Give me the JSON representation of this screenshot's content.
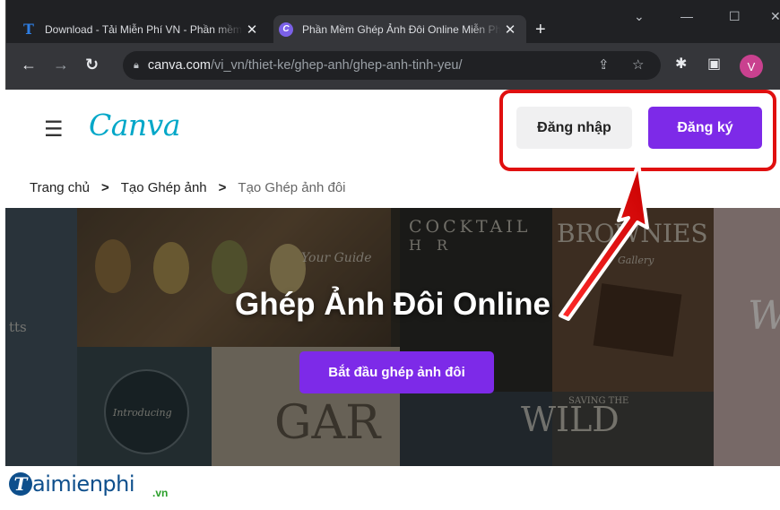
{
  "browser": {
    "tabs": [
      {
        "title": "Download - Tải Miễn Phí VN - Phần mềm",
        "favicon": "T"
      },
      {
        "title": "Phần Mềm Ghép Ảnh Đôi Online Miễn Phí",
        "favicon": "C"
      }
    ],
    "tab_close_glyph": "✕",
    "new_tab_glyph": "+",
    "address": {
      "host": "canva.com",
      "path": "/vi_vn/thiet-ke/ghep-anh/ghep-anh-tinh-yeu/"
    },
    "profile_initial": "V"
  },
  "header": {
    "logo": "Canva",
    "login_label": "Đăng nhập",
    "signup_label": "Đăng ký"
  },
  "breadcrumb": {
    "items": [
      "Trang chủ",
      "Tạo Ghép ảnh",
      "Tạo Ghép ảnh đôi"
    ],
    "separator": ">"
  },
  "hero": {
    "title": "Ghép Ảnh Đôi Online",
    "cta_label": "Bắt đầu ghép ảnh đôi",
    "tile_texts": {
      "cocktail": "COCKTAIL",
      "hr": "H R",
      "brownies": "BROWNIES",
      "gallery": "Gallery",
      "your_guide": "Your Guide",
      "wild": "WILD",
      "saving_the": "SAVING THE",
      "introducing": "Introducing",
      "gar": "GAR",
      "tts": "tts"
    }
  },
  "watermark": {
    "initial": "T",
    "name": "aimienphi",
    "tld": ".vn"
  },
  "colors": {
    "brand_purple": "#7d2ae8",
    "canva_teal": "#00a7c8",
    "annotation_red": "#e01010"
  }
}
